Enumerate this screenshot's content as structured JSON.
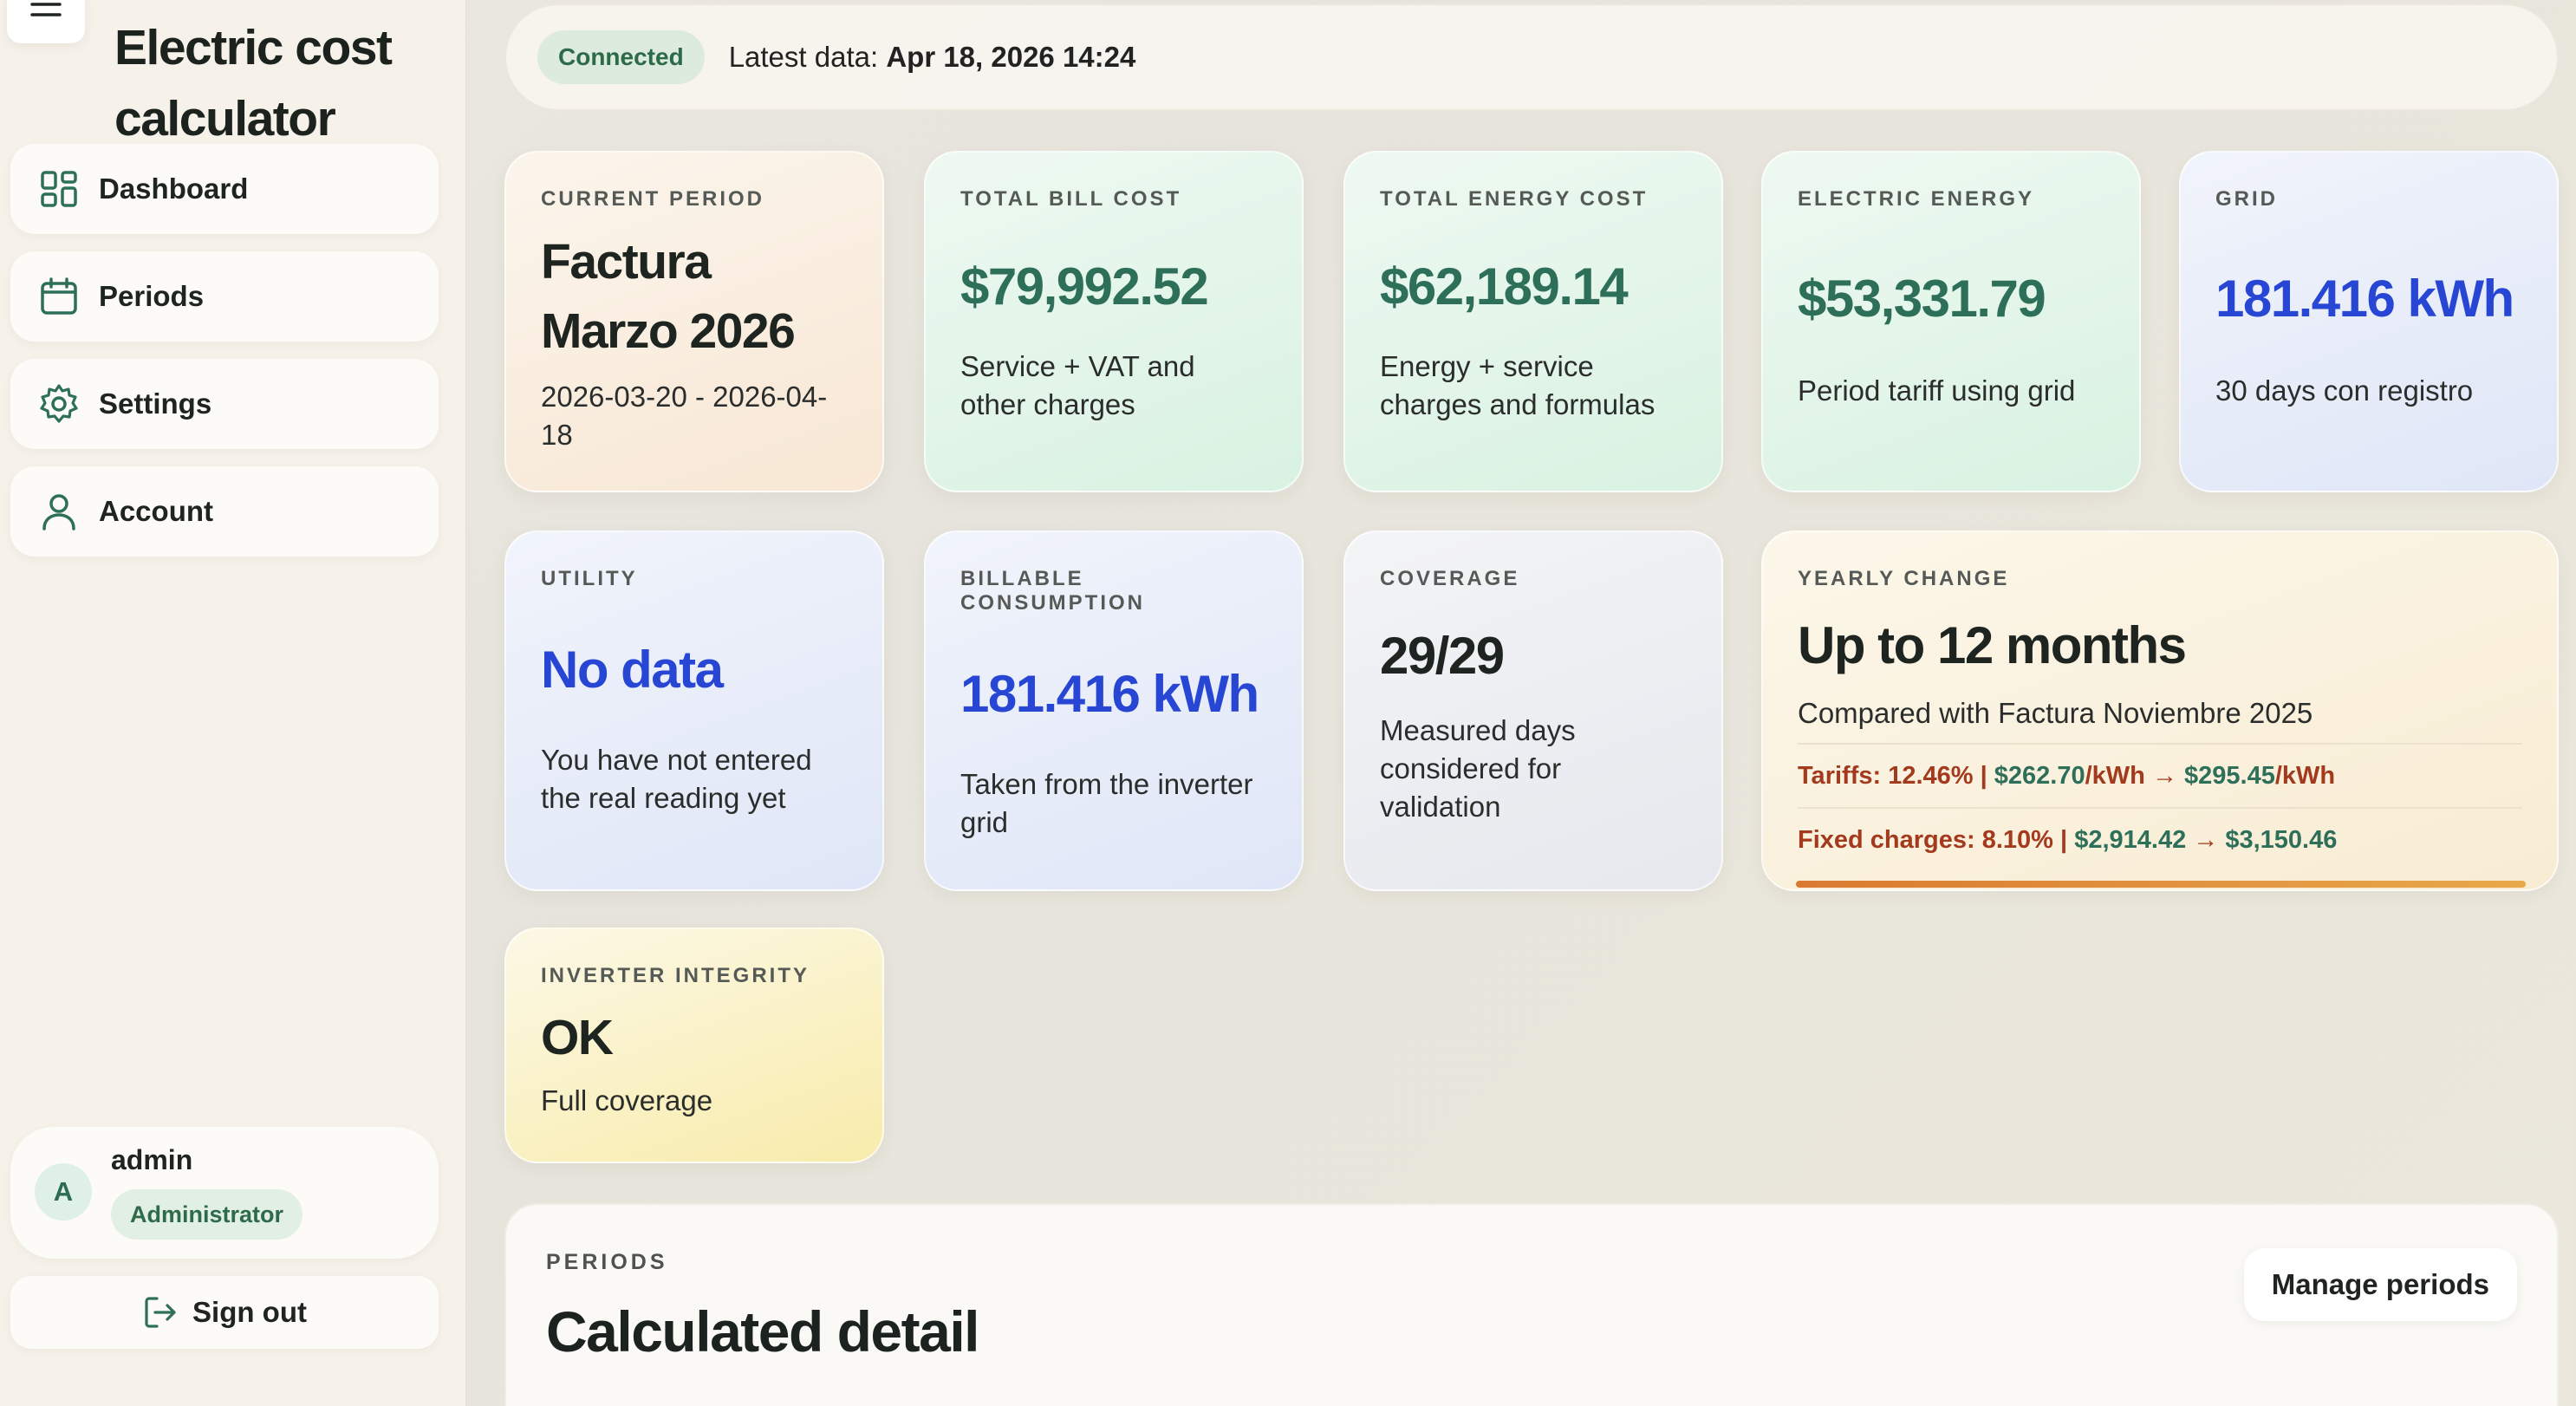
{
  "app": {
    "title": "Electric cost calculator"
  },
  "sidebar": {
    "items": [
      {
        "label": "Dashboard",
        "icon": "grid-icon"
      },
      {
        "label": "Periods",
        "icon": "calendar-icon"
      },
      {
        "label": "Settings",
        "icon": "gear-icon"
      },
      {
        "label": "Account",
        "icon": "user-icon"
      }
    ],
    "user": {
      "initial": "A",
      "name": "admin",
      "role": "Administrator"
    },
    "signout_label": "Sign out"
  },
  "topbar": {
    "status": "Connected",
    "latest_prefix": "Latest data:",
    "latest_value": "Apr 18, 2026 14:24"
  },
  "cards": {
    "current_period": {
      "label": "CURRENT PERIOD",
      "value": "Factura Marzo 2026",
      "sub": "2026-03-20 - 2026-04-18"
    },
    "total_bill": {
      "label": "TOTAL BILL COST",
      "value": "$79,992.52",
      "sub": "Service + VAT and other charges"
    },
    "total_energy": {
      "label": "TOTAL ENERGY COST",
      "value": "$62,189.14",
      "sub": "Energy + service charges and formulas"
    },
    "electric_energy": {
      "label": "ELECTRIC ENERGY",
      "value": "$53,331.79",
      "sub": "Period tariff using grid"
    },
    "grid": {
      "label": "GRID",
      "value": "181.416 kWh",
      "sub": "30 days con registro"
    },
    "utility": {
      "label": "UTILITY",
      "value": "No data",
      "sub": "You have not entered the real reading yet"
    },
    "billable": {
      "label": "BILLABLE CONSUMPTION",
      "value": "181.416 kWh",
      "sub": "Taken from the inverter grid"
    },
    "coverage": {
      "label": "COVERAGE",
      "value": "29/29",
      "sub": "Measured days considered for validation"
    },
    "yearly": {
      "label": "YEARLY CHANGE",
      "value": "Up to 12 months",
      "sub": "Compared with Factura Noviembre 2025",
      "tariffs_label": "Tariffs: 12.46%",
      "tariffs_sep": " | ",
      "tariffs_from": "$262.70",
      "tariffs_unit1": "/kWh",
      "tariffs_arrow": " → ",
      "tariffs_to": "$295.45",
      "tariffs_unit2": "/kWh",
      "fixed_label": "Fixed charges: 8.10%",
      "fixed_sep": " | ",
      "fixed_from": "$2,914.42",
      "fixed_arrow": " → ",
      "fixed_to": "$3,150.46",
      "progress": 1.0
    },
    "inverter": {
      "label": "INVERTER INTEGRITY",
      "value": "OK",
      "sub": "Full coverage"
    }
  },
  "periods": {
    "label": "PERIODS",
    "title": "Calculated detail",
    "manage_label": "Manage periods"
  }
}
